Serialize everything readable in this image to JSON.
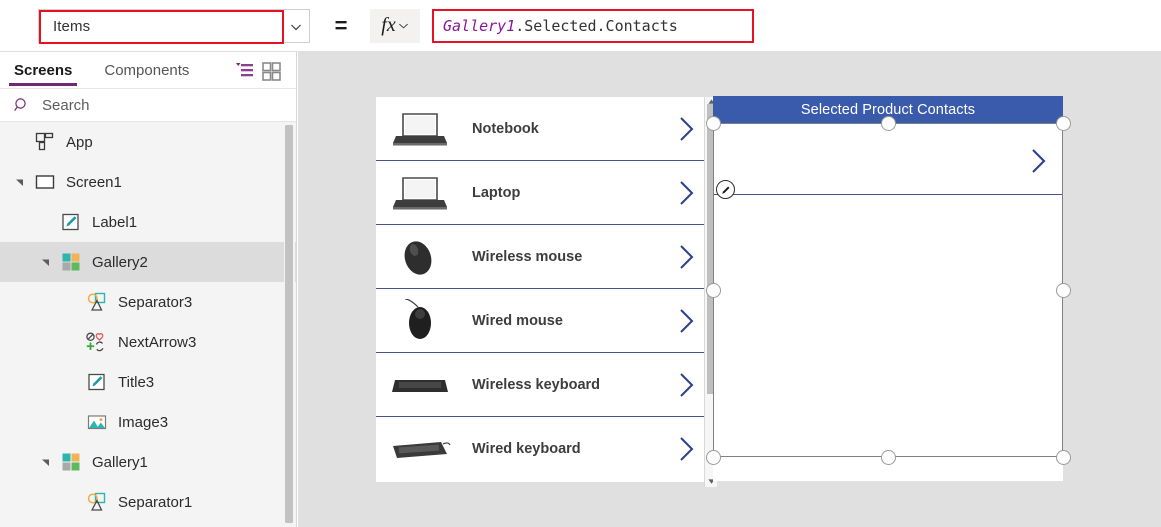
{
  "formula_bar": {
    "property_value": "Items",
    "property_dropdown_icon": "chevron-down-icon",
    "equals": "=",
    "fx_label": "fx",
    "fx_dropdown_icon": "chevron-down-icon",
    "formula_identifier": "Gallery1",
    "formula_rest": ".Selected.Contacts",
    "identifier_color": "#881798",
    "highlight_border_color": "#e81123"
  },
  "sidebar": {
    "tabs": [
      {
        "label": "Screens",
        "active": true
      },
      {
        "label": "Components",
        "active": false
      }
    ],
    "tab_accent_color": "#742774",
    "toolbar_icons": [
      {
        "name": "tree-view-icon"
      },
      {
        "name": "thumbnail-view-icon"
      }
    ],
    "search": {
      "icon": "search-icon",
      "placeholder": "Search"
    },
    "tree": [
      {
        "label": "App",
        "icon": "app-icon",
        "indent": 0,
        "caret": "none",
        "selected": false
      },
      {
        "label": "Screen1",
        "icon": "screen-icon",
        "indent": 0,
        "caret": "expanded",
        "selected": false
      },
      {
        "label": "Label1",
        "icon": "label-icon",
        "indent": 1,
        "caret": "none",
        "selected": false
      },
      {
        "label": "Gallery2",
        "icon": "gallery-icon",
        "indent": 1,
        "caret": "expanded",
        "selected": true
      },
      {
        "label": "Separator3",
        "icon": "shapes-icon",
        "indent": 2,
        "caret": "none",
        "selected": false
      },
      {
        "label": "NextArrow3",
        "icon": "icon-set-icon",
        "indent": 2,
        "caret": "none",
        "selected": false
      },
      {
        "label": "Title3",
        "icon": "label-icon",
        "indent": 2,
        "caret": "none",
        "selected": false
      },
      {
        "label": "Image3",
        "icon": "image-icon",
        "indent": 2,
        "caret": "none",
        "selected": false
      },
      {
        "label": "Gallery1",
        "icon": "gallery-icon",
        "indent": 1,
        "caret": "expanded",
        "selected": false
      },
      {
        "label": "Separator1",
        "icon": "shapes-icon",
        "indent": 2,
        "caret": "none",
        "selected": false
      }
    ],
    "selected_row_bg": "#dcdcdc"
  },
  "canvas": {
    "background": "#e0e0e0",
    "left_gallery": {
      "name": "product-gallery",
      "separator_color": "#48538c",
      "chevron_color": "#2b3f8c",
      "items": [
        {
          "title": "Notebook",
          "image": "notebook-thumbnail",
          "chevron": "chevron-right-icon"
        },
        {
          "title": "Laptop",
          "image": "laptop-thumbnail",
          "chevron": "chevron-right-icon"
        },
        {
          "title": "Wireless mouse",
          "image": "wireless-mouse-thumbnail",
          "chevron": "chevron-right-icon"
        },
        {
          "title": "Wired mouse",
          "image": "wired-mouse-thumbnail",
          "chevron": "chevron-right-icon"
        },
        {
          "title": "Wireless keyboard",
          "image": "wireless-keyboard-thumbnail",
          "chevron": "chevron-right-icon"
        },
        {
          "title": "Wired keyboard",
          "image": "wired-keyboard-thumbnail",
          "chevron": "chevron-right-icon"
        }
      ],
      "scrollbar": {
        "up_arrow_icon": "scroll-up-arrow-icon",
        "down_arrow_icon": "scroll-down-arrow-icon"
      }
    },
    "right_gallery": {
      "name": "selected-product-contacts-gallery",
      "header_title": "Selected Product Contacts",
      "header_color": "#3a5bab",
      "header_text_color": "#ffffff",
      "separator_color": "#48538c",
      "chevron": "chevron-right-icon",
      "selected": true,
      "edit_badge_icon": "pencil-icon",
      "handle_count": 8
    }
  }
}
